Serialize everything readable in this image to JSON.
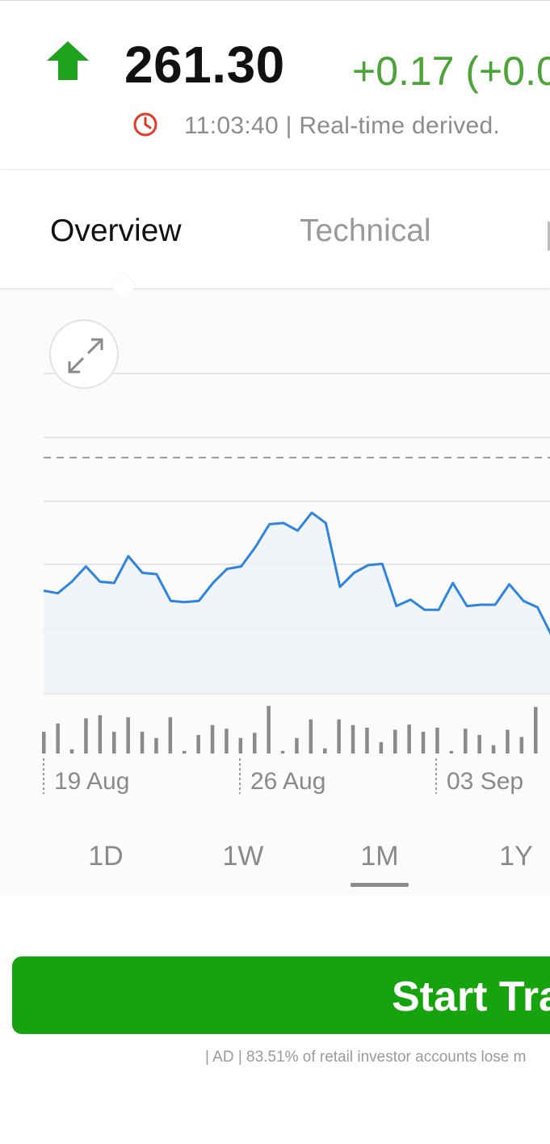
{
  "quote": {
    "price": "261.30",
    "change": "+0.17 (+0.0",
    "timestamp": "11:03:40 | Real-time derived.",
    "direction_icon": "up-arrow-icon",
    "clock_icon": "clock-icon",
    "colors": {
      "up": "#1fa31f",
      "change": "#4ca338",
      "clock": "#e0392a"
    }
  },
  "tabs": [
    {
      "label": "Overview",
      "active": true
    },
    {
      "label": "Technical",
      "active": false
    }
  ],
  "chart": {
    "expand_icon": "expand-arrows-icon",
    "line_color": "#2d85e0",
    "x_labels": [
      "19 Aug",
      "26 Aug",
      "03 Sep"
    ]
  },
  "chart_data": {
    "type": "line",
    "x_tick_labels": [
      "19 Aug",
      "26 Aug",
      "03 Sep"
    ],
    "series": [
      {
        "values": [
          0.3,
          0.28,
          0.37,
          0.49,
          0.37,
          0.36,
          0.57,
          0.44,
          0.43,
          0.22,
          0.21,
          0.22,
          0.36,
          0.47,
          0.49,
          0.64,
          0.82,
          0.83,
          0.77,
          0.91,
          0.83,
          0.33,
          0.44,
          0.5,
          0.51,
          0.18,
          0.23,
          0.15,
          0.15,
          0.36,
          0.18,
          0.19,
          0.19,
          0.35,
          0.22,
          0.17,
          -0.05
        ]
      }
    ],
    "volume": [
      0.42,
      0.58,
      0.08,
      0.68,
      0.74,
      0.42,
      0.7,
      0.42,
      0.3,
      0.7,
      0.05,
      0.36,
      0.55,
      0.48,
      0.3,
      0.4,
      0.92,
      0.05,
      0.3,
      0.66,
      0.1,
      0.66,
      0.55,
      0.5,
      0.22,
      0.46,
      0.56,
      0.42,
      0.5,
      0.05,
      0.48,
      0.36,
      0.16,
      0.46,
      0.32,
      0.9
    ]
  },
  "ranges": [
    {
      "label": "1D",
      "active": false
    },
    {
      "label": "1W",
      "active": false
    },
    {
      "label": "1M",
      "active": true
    },
    {
      "label": "1Y",
      "active": false
    }
  ],
  "cta": {
    "label": "Start Tra"
  },
  "disclaimer": "| AD | 83.51% of retail investor accounts lose m"
}
